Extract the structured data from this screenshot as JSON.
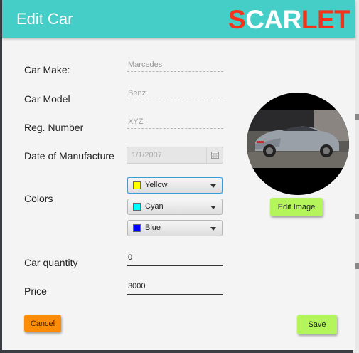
{
  "window": {
    "title": "Edit Car",
    "logo": {
      "part1": "S",
      "part2": "CAR",
      "part3": "LET"
    }
  },
  "form": {
    "make": {
      "label": "Car Make:",
      "placeholder": "Marcedes"
    },
    "model": {
      "label": "Car Model",
      "placeholder": "Benz"
    },
    "reg": {
      "label": "Reg. Number",
      "placeholder": "XYZ"
    },
    "date": {
      "label": "Date of Manufacture",
      "placeholder": "1/1/2007"
    },
    "colors": {
      "label": "Colors",
      "items": [
        {
          "name": "Yellow",
          "swatch": "#ffff00"
        },
        {
          "name": "Cyan",
          "swatch": "#00ffff"
        },
        {
          "name": "Blue",
          "swatch": "#0000ff"
        }
      ]
    },
    "quantity": {
      "label": "Car quantity",
      "value": "0"
    },
    "price": {
      "label": "Price",
      "value": "3000"
    }
  },
  "buttons": {
    "edit_image": "Edit Image",
    "cancel": "Cancel",
    "save": "Save"
  },
  "colors": {
    "titlebar": "#45cdc7",
    "logo_red": "#f5321a",
    "button_green": "#b3f55a",
    "button_orange": "#fd8c08"
  }
}
